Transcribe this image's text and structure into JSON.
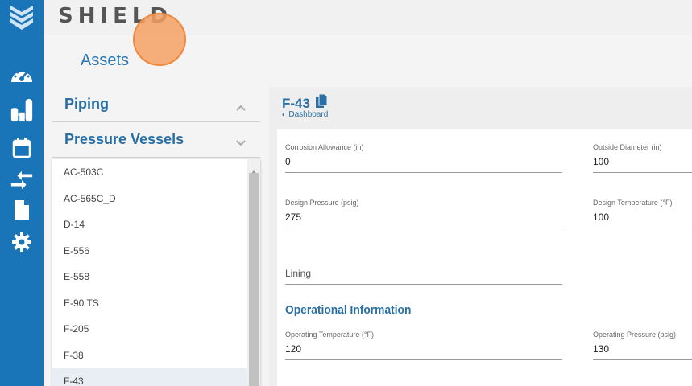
{
  "app": {
    "brand": "SHIELD",
    "logo_icon": "shield-chevron-logo-icon",
    "accent": "#1a74b8",
    "link_color": "#2a6fa4"
  },
  "nav": {
    "items": [
      {
        "icon": "gauge-icon"
      },
      {
        "icon": "tanks-icon"
      },
      {
        "icon": "calendar-icon"
      },
      {
        "icon": "arrows-merge-icon"
      },
      {
        "icon": "document-icon"
      },
      {
        "icon": "gear-icon"
      }
    ]
  },
  "page": {
    "title": "Assets"
  },
  "categories": [
    {
      "label": "Piping",
      "state": "collapsed",
      "chevron": "chevron-up-icon"
    },
    {
      "label": "Pressure Vessels",
      "state": "expanded",
      "chevron": "chevron-down-icon"
    }
  ],
  "asset_list": {
    "items": [
      "AC-503C",
      "AC-565C_D",
      "D-14",
      "E-556",
      "E-558",
      "E-90 TS",
      "F-205",
      "F-38",
      "F-43"
    ],
    "selected": "F-43"
  },
  "detail": {
    "asset_name": "F-43",
    "copy_icon": "copy-icon",
    "back_label": "Dashboard",
    "fields": {
      "corrosion_allowance": {
        "label": "Corrosion Allowance (in)",
        "value": "0"
      },
      "outside_diameter": {
        "label": "Outside Diameter (in)",
        "value": "100"
      },
      "design_pressure": {
        "label": "Design Pressure (psig)",
        "value": "275"
      },
      "design_temperature": {
        "label": "Design Temperature (°F)",
        "value": "100"
      },
      "lining": {
        "placeholder": "Lining"
      },
      "operating_temperature": {
        "label": "Operating Temperature (°F)",
        "value": "120"
      },
      "operating_pressure": {
        "label": "Operating Pressure (psig)",
        "value": "130"
      }
    },
    "section_operational": "Operational Information"
  }
}
